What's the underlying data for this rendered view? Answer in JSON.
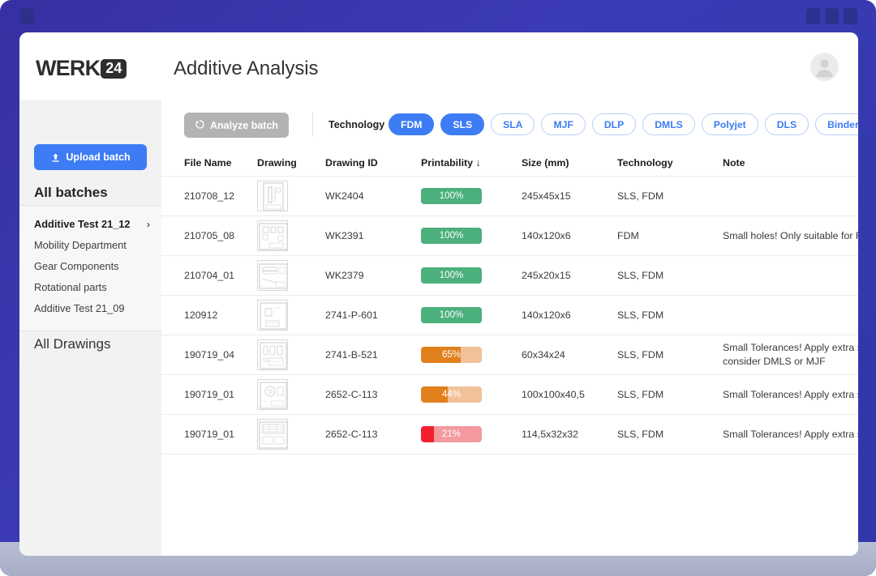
{
  "window": {
    "titlebar_dots": [
      "dot",
      "dot",
      "dot"
    ],
    "chrome_color": "#3b3bb5"
  },
  "header": {
    "logo_text": "WERK",
    "logo_badge": "24",
    "page_title": "Additive Analysis",
    "avatar_name": "user-avatar"
  },
  "sidebar": {
    "upload_button_label": "Upload batch",
    "upload_icon": "upload-icon",
    "all_batches_title": "All batches",
    "all_drawings_title": "All Drawings",
    "chevron": "›",
    "items": [
      {
        "label": "Additive Test 21_12",
        "active": true
      },
      {
        "label": "Mobility Department",
        "active": false
      },
      {
        "label": "Gear Components",
        "active": false
      },
      {
        "label": "Rotational parts",
        "active": false
      },
      {
        "label": "Additive Test 21_09",
        "active": false
      }
    ]
  },
  "toolbar": {
    "analyze_button_label": "Analyze batch",
    "analyze_icon": "refresh-icon",
    "technology_label": "Technology",
    "chips": [
      {
        "label": "FDM",
        "active": true
      },
      {
        "label": "SLS",
        "active": true
      },
      {
        "label": "SLA",
        "active": false
      },
      {
        "label": "MJF",
        "active": false
      },
      {
        "label": "DLP",
        "active": false
      },
      {
        "label": "DMLS",
        "active": false
      },
      {
        "label": "Polyjet",
        "active": false
      },
      {
        "label": "DLS",
        "active": false
      },
      {
        "label": "Binder Jetting",
        "active": false
      }
    ]
  },
  "table": {
    "columns": [
      "File Name",
      "Drawing",
      "Drawing ID",
      "Printability ↓",
      "Size (mm)",
      "Technology",
      "Note",
      ""
    ],
    "sort_column": "Printability",
    "sort_direction": "desc",
    "kebab_glyph": "•••",
    "rows": [
      {
        "file_name": "210708_12",
        "drawing_id": "WK2404",
        "printability": "100%",
        "printability_value": 100,
        "fill_color": "#4cb07c",
        "track_color": "#4cb07c",
        "size": "245x45x15",
        "technology": "SLS, FDM",
        "note": "",
        "has_kebab": true,
        "thumb_style": "portrait-shaft"
      },
      {
        "file_name": "210705_08",
        "drawing_id": "WK2391",
        "printability": "100%",
        "printability_value": 100,
        "fill_color": "#4cb07c",
        "track_color": "#4cb07c",
        "size": "140x120x6",
        "technology": "FDM",
        "note": "Small holes! Only suitable for FDM",
        "has_kebab": false,
        "thumb_style": "multi-view"
      },
      {
        "file_name": "210704_01",
        "drawing_id": "WK2379",
        "printability": "100%",
        "printability_value": 100,
        "fill_color": "#4cb07c",
        "track_color": "#4cb07c",
        "size": "245x20x15",
        "technology": "SLS, FDM",
        "note": "",
        "has_kebab": false,
        "thumb_style": "table-block"
      },
      {
        "file_name": "120912",
        "drawing_id": "2741-P-601",
        "printability": "100%",
        "printability_value": 100,
        "fill_color": "#4cb07c",
        "track_color": "#4cb07c",
        "size": "140x120x6",
        "technology": "SLS, FDM",
        "note": "",
        "has_kebab": false,
        "thumb_style": "sparse"
      },
      {
        "file_name": "190719_04",
        "drawing_id": "2741-B-521",
        "printability": "65%",
        "printability_value": 65,
        "fill_color": "#e2801e",
        "track_color": "#f1c199",
        "size": "60x34x24",
        "technology": "SLS, FDM",
        "note": "Small Tolerances! Apply extra steps or consider DMLS or MJF",
        "has_kebab": false,
        "thumb_style": "three-view"
      },
      {
        "file_name": "190719_01",
        "drawing_id": "2652-C-113",
        "printability": "44%",
        "printability_value": 44,
        "fill_color": "#e2801e",
        "track_color": "#f1c199",
        "size": "100x100x40,5",
        "technology": "SLS, FDM",
        "note": "Small Tolerances! Apply extra steps.",
        "has_kebab": false,
        "thumb_style": "round-part"
      },
      {
        "file_name": "190719_01",
        "drawing_id": "2652-C-113",
        "printability": "21%",
        "printability_value": 21,
        "fill_color": "#f3212f",
        "track_color": "#f49a9f",
        "size": "114,5x32x32",
        "technology": "SLS, FDM",
        "note": "Small Tolerances! Apply extra steps.",
        "has_kebab": false,
        "thumb_style": "dense"
      }
    ]
  }
}
